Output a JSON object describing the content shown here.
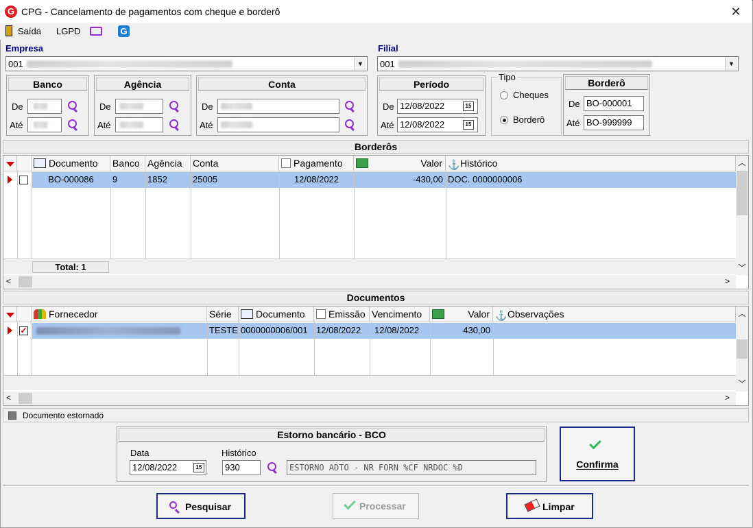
{
  "window": {
    "title": "CPG - Cancelamento de pagamentos com cheque e borderô",
    "app_icon": "G"
  },
  "menu": {
    "saida": "Saída",
    "lgpd": "LGPD"
  },
  "filters": {
    "empresa_label": "Empresa",
    "empresa_value": "001",
    "filial_label": "Filial",
    "filial_value": "001",
    "banco": {
      "title": "Banco",
      "de": "De",
      "ate": "Até"
    },
    "agencia": {
      "title": "Agência",
      "de": "De",
      "ate": "Até"
    },
    "conta": {
      "title": "Conta",
      "de": "De",
      "ate": "Até"
    },
    "periodo": {
      "title": "Período",
      "de": "De",
      "ate": "Até",
      "de_value": "12/08/2022",
      "ate_value": "12/08/2022"
    },
    "tipo": {
      "title": "Tipo",
      "cheques": "Cheques",
      "bordero": "Borderô"
    },
    "bordero": {
      "title": "Borderô",
      "de": "De",
      "ate": "Até",
      "de_value": "BO-000001",
      "ate_value": "BO-999999"
    }
  },
  "borderos": {
    "title": "Borderôs",
    "columns": {
      "documento": "Documento",
      "banco": "Banco",
      "agencia": "Agência",
      "conta": "Conta",
      "pagamento": "Pagamento",
      "valor": "Valor",
      "historico": "Histórico"
    },
    "row": {
      "documento": "BO-000086",
      "banco": "9",
      "agencia": "1852",
      "conta": "25005",
      "pagamento": "12/08/2022",
      "valor": "-430,00",
      "historico": "DOC. 0000000006"
    },
    "total": "Total: 1"
  },
  "documentos": {
    "title": "Documentos",
    "columns": {
      "fornecedor": "Fornecedor",
      "serie": "Série",
      "documento": "Documento",
      "emissao": "Emissão",
      "vencimento": "Vencimento",
      "valor": "Valor",
      "observacoes": "Observações"
    },
    "row": {
      "serie": "TESTE",
      "documento": "0000000006/001",
      "emissao": "12/08/2022",
      "vencimento": "12/08/2022",
      "valor": "430,00"
    },
    "legend": "Documento estornado"
  },
  "estorno": {
    "title": "Estorno bancário - BCO",
    "data_label": "Data",
    "data_value": "12/08/2022",
    "historico_label": "Histórico",
    "historico_code": "930",
    "historico_text": "ESTORNO ADTO - NR FORN %CF NRDOC %D",
    "confirma": "Confirma"
  },
  "buttons": {
    "pesquisar": "Pesquisar",
    "processar": "Processar",
    "limpar": "Limpar"
  },
  "colors": {
    "selected_row": "#a6c7f0",
    "label_blue": "#00007f",
    "accent_purple": "#8f2fd1",
    "confirm_green": "#2eb85c"
  }
}
